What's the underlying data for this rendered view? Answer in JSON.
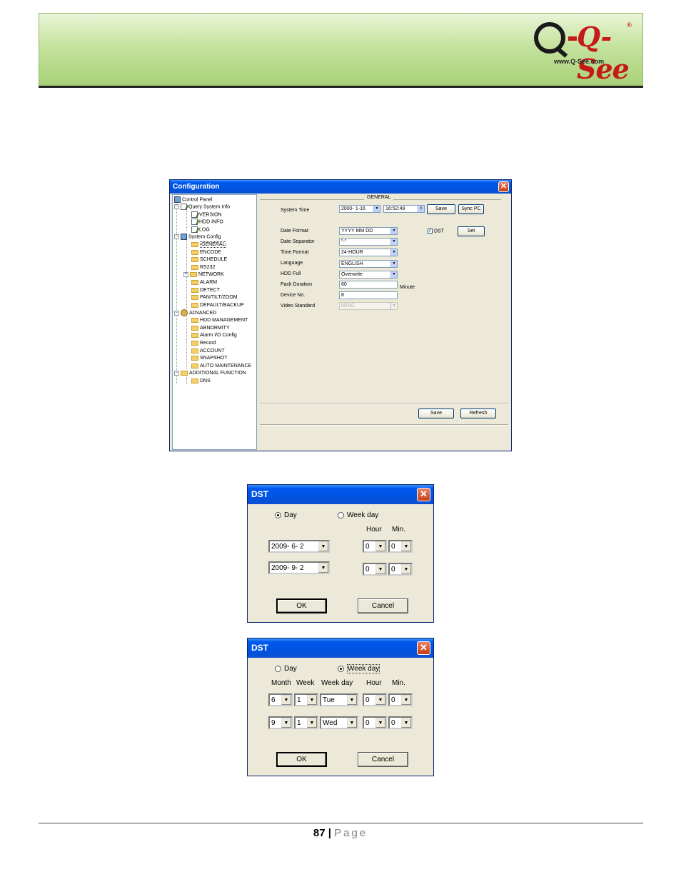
{
  "header": {
    "logo_brand": "Q-See",
    "logo_reg": "®",
    "logo_url": "www.Q-See.com"
  },
  "config_window": {
    "title": "Configuration",
    "close_glyph": "✕",
    "tree": {
      "control_panel": "Control Panel",
      "query_system_info": "Query System Info",
      "version": "VERSION",
      "hdd_info": "HDD INFO",
      "log": "LOG",
      "system_config": "System Config",
      "general": "GENERAL",
      "encode": "ENCODE",
      "schedule": "SCHEDULE",
      "rs232": "RS232",
      "network": "NETWORK",
      "alarm": "ALARM",
      "detect": "DETECT",
      "ptz": "PAN/TILT/ZOOM",
      "default_backup": "DEFAULT/BACKUP",
      "advanced": "ADVANCED",
      "hdd_management": "HDD MANAGEMENT",
      "abnormity": "ABNORMITY",
      "alarm_io": "Alarm I/O Config",
      "record": "Record",
      "account": "ACCOUNT",
      "snapshot": "SNAPSHOT",
      "auto_maintenance": "AUTO MAINTENANCE",
      "additional_function": "ADDITIONAL FUNCTION",
      "dns": "DNS"
    },
    "general": {
      "section_title": "GENERAL",
      "system_time_label": "System Time",
      "date_value": "2000- 1-16",
      "time_value": "16:52:49",
      "save_time_btn": "Save",
      "sync_pc_btn": "Sync PC",
      "date_format_label": "Date Format",
      "date_format_value": "YYYY MM DD",
      "dst_label": "DST",
      "dst_checked": "✓",
      "set_btn": "Set",
      "date_separator_label": "Date Separator",
      "date_separator_value": "\"-\"",
      "time_format_label": "Time Format",
      "time_format_value": "24-HOUR",
      "language_label": "Language",
      "language_value": "ENGLISH",
      "hdd_full_label": "HDD Full",
      "hdd_full_value": "Overwrite",
      "pack_duration_label": "Pack Duration",
      "pack_duration_value": "60",
      "minute_label": "Minute",
      "device_no_label": "Device No.",
      "device_no_value": "8",
      "video_standard_label": "Video Standard",
      "video_standard_value": "NTSC",
      "save_btn": "Save",
      "refresh_btn": "Refresh"
    }
  },
  "dst_day": {
    "title": "DST",
    "close_glyph": "✕",
    "radio_day": "Day",
    "radio_week": "Week day",
    "hour_label": "Hour",
    "min_label": "Min.",
    "start_date": "2009- 6- 2",
    "end_date": "2009- 9- 2",
    "start_hour": "0",
    "start_min": "0",
    "end_hour": "0",
    "end_min": "0",
    "ok": "OK",
    "cancel": "Cancel"
  },
  "dst_week": {
    "title": "DST",
    "close_glyph": "✕",
    "radio_day": "Day",
    "radio_week": "Week day",
    "month_label": "Month",
    "week_label": "Week",
    "weekday_label": "Week day",
    "hour_label": "Hour",
    "min_label": "Min.",
    "start_month": "6",
    "start_week": "1",
    "start_weekday": "Tue",
    "start_hour": "0",
    "start_min": "0",
    "end_month": "9",
    "end_week": "1",
    "end_weekday": "Wed",
    "end_hour": "0",
    "end_min": "0",
    "ok": "OK",
    "cancel": "Cancel"
  },
  "footer": {
    "page_number": "87",
    "separator": "|",
    "page_word": "Page"
  },
  "glyphs": {
    "dropdown": "▼",
    "spin": "⇕",
    "minus": "−",
    "plus": "+"
  }
}
